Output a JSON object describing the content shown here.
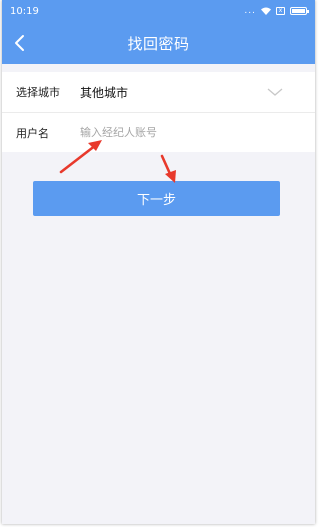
{
  "status_bar": {
    "time": "10:19",
    "signal_dots": "...",
    "sim_badge": "x",
    "battery_level": 0.85
  },
  "nav": {
    "title": "找回密码",
    "back_icon": "chevron-left-icon"
  },
  "form": {
    "city_label": "选择城市",
    "city_value": "其他城市",
    "username_label": "用户名",
    "username_value": "",
    "username_placeholder": "输入经纪人账号"
  },
  "next_button": {
    "label": "下一步"
  },
  "colors": {
    "primary": "#5b9bf0",
    "page_bg": "#f3f3f8",
    "annotation_arrow": "#e8392c"
  }
}
